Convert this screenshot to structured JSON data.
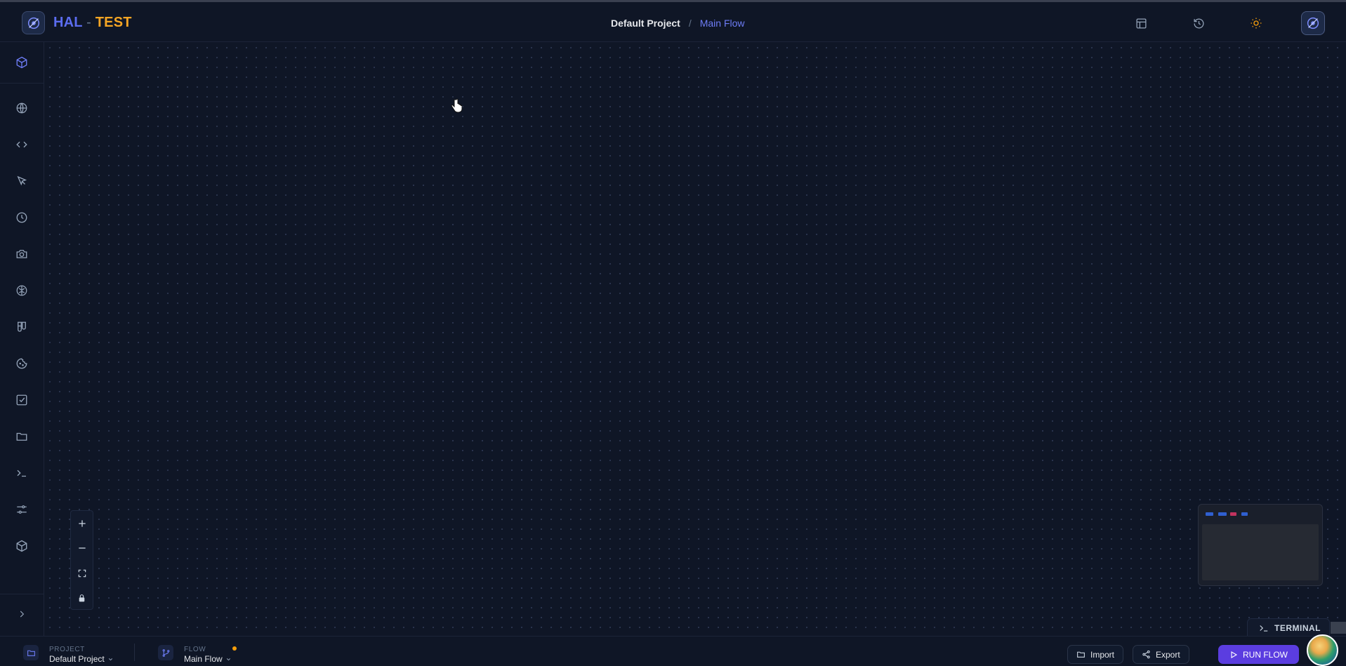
{
  "app": {
    "brand_hal": "HAL",
    "brand_dash": "-",
    "brand_test": "TEST",
    "accent_color": "#5b6cf0",
    "brand_test_color": "#f5a524"
  },
  "breadcrumb": {
    "project": "Default Project",
    "separator": "/",
    "flow": "Main Flow"
  },
  "header_icons": [
    "layout-icon",
    "history-icon",
    "sun-icon",
    "app-avatar-icon"
  ],
  "sidebar": {
    "items": [
      "cube-icon",
      "globe-icon",
      "code-icon",
      "cursor-click-icon",
      "clock-icon",
      "camera-icon",
      "brain-icon",
      "test-tubes-icon",
      "cookie-icon",
      "checkbox-icon",
      "folder-icon",
      "terminal-icon",
      "sliders-icon",
      "package-icon"
    ],
    "expand_icon": "chevron-right-icon"
  },
  "canvas_controls": [
    "zoom-in-icon",
    "zoom-out-icon",
    "fit-view-icon",
    "lock-icon"
  ],
  "terminal": {
    "label": "TERMINAL"
  },
  "footer": {
    "project_label": "PROJECT",
    "project_value": "Default Project",
    "flow_label": "FLOW",
    "flow_value": "Main Flow",
    "import_label": "Import",
    "export_label": "Export",
    "run_label": "RUN FLOW",
    "run_color": "#5b3de0"
  }
}
